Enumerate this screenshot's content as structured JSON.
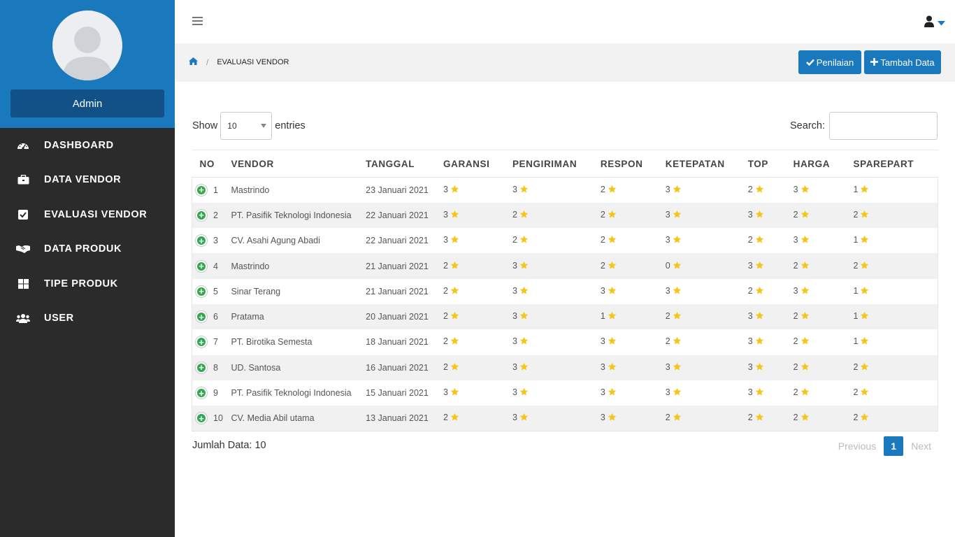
{
  "sidebar": {
    "user_label": "Admin",
    "items": [
      {
        "label": "DASHBOARD",
        "icon": "dashboard-icon"
      },
      {
        "label": "DATA VENDOR",
        "icon": "briefcase-icon"
      },
      {
        "label": "EVALUASI VENDOR",
        "icon": "check-square-icon"
      },
      {
        "label": "DATA PRODUK",
        "icon": "handshake-icon"
      },
      {
        "label": "TIPE PRODUK",
        "icon": "grid-icon"
      },
      {
        "label": "USER",
        "icon": "users-icon"
      }
    ]
  },
  "topbar": {
    "menu_icon": "hamburger-icon",
    "user_icon": "user-icon"
  },
  "breadcrumb": {
    "home_icon": "home-icon",
    "current": "EVALUASI VENDOR"
  },
  "actions": {
    "penilaian": "Penilaian",
    "tambah": "Tambah Data"
  },
  "controls": {
    "show_label": "Show",
    "entries_value": "10",
    "entries_label": "entries",
    "search_label": "Search:"
  },
  "table": {
    "headers": [
      "NO",
      "VENDOR",
      "TANGGAL",
      "GARANSI",
      "PENGIRIMAN",
      "RESPON",
      "KETEPATAN",
      "TOP",
      "HARGA",
      "SPAREPART"
    ],
    "rows": [
      {
        "no": "1",
        "vendor": "Mastrindo",
        "tanggal": "23 Januari 2021",
        "garansi": "3",
        "pengiriman": "3",
        "respon": "2",
        "ketepatan": "3",
        "top": "2",
        "harga": "3",
        "sparepart": "1"
      },
      {
        "no": "2",
        "vendor": "PT. Pasifik Teknologi Indonesia",
        "tanggal": "22 Januari 2021",
        "garansi": "3",
        "pengiriman": "2",
        "respon": "2",
        "ketepatan": "3",
        "top": "3",
        "harga": "2",
        "sparepart": "2"
      },
      {
        "no": "3",
        "vendor": "CV. Asahi Agung Abadi",
        "tanggal": "22 Januari 2021",
        "garansi": "3",
        "pengiriman": "2",
        "respon": "2",
        "ketepatan": "3",
        "top": "2",
        "harga": "3",
        "sparepart": "1"
      },
      {
        "no": "4",
        "vendor": "Mastrindo",
        "tanggal": "21 Januari 2021",
        "garansi": "2",
        "pengiriman": "3",
        "respon": "2",
        "ketepatan": "0",
        "top": "3",
        "harga": "2",
        "sparepart": "2"
      },
      {
        "no": "5",
        "vendor": "Sinar Terang",
        "tanggal": "21 Januari 2021",
        "garansi": "2",
        "pengiriman": "3",
        "respon": "3",
        "ketepatan": "3",
        "top": "2",
        "harga": "3",
        "sparepart": "1"
      },
      {
        "no": "6",
        "vendor": "Pratama",
        "tanggal": "20 Januari 2021",
        "garansi": "2",
        "pengiriman": "3",
        "respon": "1",
        "ketepatan": "2",
        "top": "3",
        "harga": "2",
        "sparepart": "1"
      },
      {
        "no": "7",
        "vendor": "PT. Birotika Semesta",
        "tanggal": "18 Januari 2021",
        "garansi": "2",
        "pengiriman": "3",
        "respon": "3",
        "ketepatan": "2",
        "top": "3",
        "harga": "2",
        "sparepart": "1"
      },
      {
        "no": "8",
        "vendor": "UD. Santosa",
        "tanggal": "16 Januari 2021",
        "garansi": "2",
        "pengiriman": "3",
        "respon": "3",
        "ketepatan": "3",
        "top": "3",
        "harga": "2",
        "sparepart": "2"
      },
      {
        "no": "9",
        "vendor": "PT. Pasifik Teknologi Indonesia",
        "tanggal": "15 Januari 2021",
        "garansi": "3",
        "pengiriman": "3",
        "respon": "3",
        "ketepatan": "3",
        "top": "3",
        "harga": "2",
        "sparepart": "2"
      },
      {
        "no": "10",
        "vendor": "CV. Media Abil utama",
        "tanggal": "13 Januari 2021",
        "garansi": "2",
        "pengiriman": "3",
        "respon": "3",
        "ketepatan": "2",
        "top": "2",
        "harga": "2",
        "sparepart": "2"
      }
    ]
  },
  "footer": {
    "jumlah": "Jumlah Data: 10",
    "previous": "Previous",
    "current_page": "1",
    "next": "Next"
  },
  "colors": {
    "primary": "#1a78bd",
    "sidebar_bg": "#2b2b2b",
    "admin_btn": "#125188",
    "star": "#f5c518",
    "plus": "#2fa84f"
  }
}
